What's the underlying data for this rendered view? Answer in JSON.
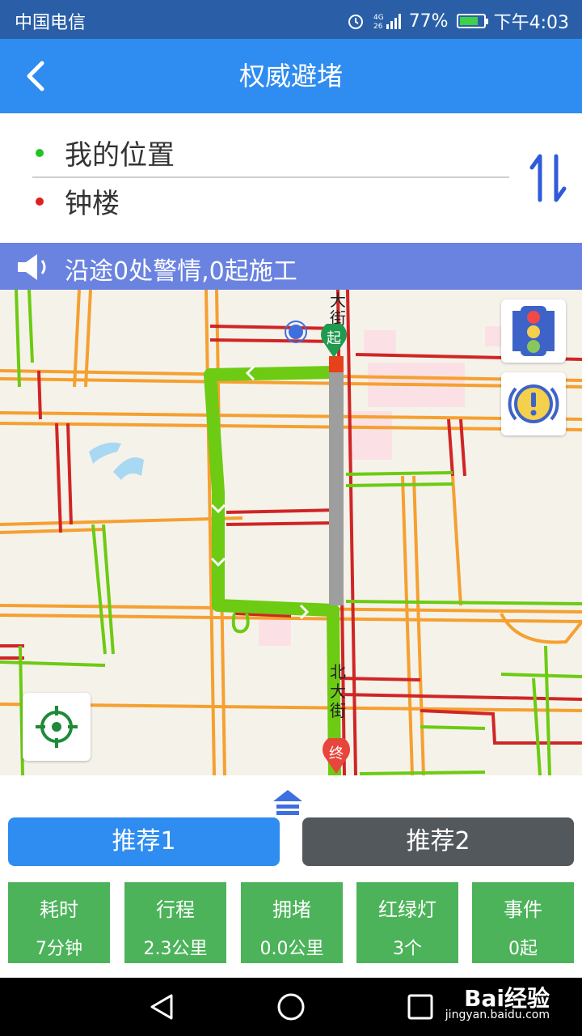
{
  "status_bar": {
    "carrier": "中国电信",
    "network": "4G 26",
    "battery": "77%",
    "battery_level": 0.77,
    "time": "下午4:03"
  },
  "header": {
    "title": "权威避堵",
    "back_icon": "chevron-left-icon"
  },
  "route": {
    "origin": "我的位置",
    "destination": "钟楼",
    "origin_color": "#22c322",
    "destination_color": "#e02020",
    "swap_icon": "swap-vertical-icon"
  },
  "alert": {
    "text": "沿途0处警情,0起施工",
    "icon": "speaker-icon"
  },
  "map": {
    "street_labels": [
      "大街",
      "北大街"
    ],
    "start_marker": "起",
    "end_marker": "终",
    "traffic_button_icon": "traffic-light-icon",
    "event_button_icon": "warning-icon",
    "locate_button_icon": "crosshair-icon"
  },
  "tabs": [
    {
      "label": "推荐1",
      "active": true
    },
    {
      "label": "推荐2",
      "active": false
    }
  ],
  "stats": [
    {
      "label": "耗时",
      "value": "7分钟"
    },
    {
      "label": "行程",
      "value": "2.3公里"
    },
    {
      "label": "拥堵",
      "value": "0.0公里"
    },
    {
      "label": "红绿灯",
      "value": "3个"
    },
    {
      "label": "事件",
      "value": "0起"
    }
  ],
  "watermark": {
    "brand": "Bai经验",
    "url": "jingyan.baidu.com"
  },
  "colors": {
    "primary": "#2f8cf0",
    "status_bar": "#2a5fa8",
    "alert_bar": "#6a83e0",
    "stat_green": "#4cb35a",
    "tab_inactive": "#53585d",
    "route_green": "#6ccb12",
    "route_gray": "#9e9e9e"
  }
}
